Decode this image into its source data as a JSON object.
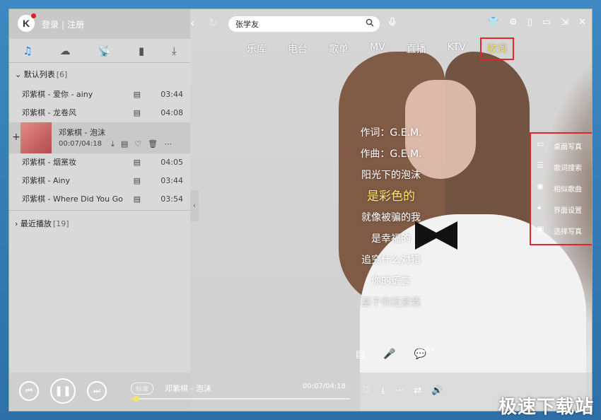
{
  "header": {
    "logo": "K",
    "login": "登录",
    "register": "注册",
    "search_value": "张学友",
    "back_icon": "‹",
    "refresh_icon": "↻",
    "search_icon": "⚲",
    "mic_icon": "🎙",
    "window_controls": [
      "skin-icon",
      "settings-icon",
      "mini-icon",
      "minimize-icon",
      "restore-icon",
      "close-icon"
    ]
  },
  "nav": {
    "tabs": [
      "乐库",
      "电台",
      "歌单",
      "MV",
      "直播",
      "KTV",
      "歌词"
    ],
    "active": "歌词"
  },
  "sidebar": {
    "icons": [
      "music-icon",
      "cloud-icon",
      "radio-icon",
      "device-icon",
      "download-icon"
    ],
    "default_list": {
      "title": "默认列表",
      "count": "[6]"
    },
    "songs": [
      {
        "title": "邓紫棋 - 爱你 - ainy",
        "duration": "03:44"
      },
      {
        "title": "邓紫棋 - 龙卷风",
        "duration": "04:08"
      }
    ],
    "playing": {
      "title": "邓紫棋 - 泡沫",
      "time": "00:07/04:18"
    },
    "songs_after": [
      {
        "title": "邓紫棋 - 烟黨妆",
        "duration": "04:05"
      },
      {
        "title": "邓紫棋 - Ainy",
        "duration": "03:44"
      },
      {
        "title": "邓紫棋 - Where Did You Go",
        "duration": "03:54"
      }
    ],
    "recent": {
      "title": "最近播放",
      "count": "[19]"
    }
  },
  "lyrics": {
    "lines": [
      {
        "text": "作词：G.E.M.",
        "state": "normal"
      },
      {
        "text": "作曲：G.E.M.",
        "state": "normal"
      },
      {
        "text": "阳光下的泡沫",
        "state": "normal"
      },
      {
        "text": "是彩色的",
        "state": "current"
      },
      {
        "text": "就像被骗的我",
        "state": "normal"
      },
      {
        "text": "是幸福的",
        "state": "normal"
      },
      {
        "text": "追究什么对错",
        "state": "normal"
      },
      {
        "text": "你的谎言",
        "state": "normal"
      },
      {
        "text": "基于你还爱我",
        "state": "fade"
      }
    ],
    "comment_count": "999+"
  },
  "right_menu": [
    {
      "label": "桌面写真",
      "icon": "desktop-photo-icon"
    },
    {
      "label": "歌词搜索",
      "icon": "lyric-search-icon"
    },
    {
      "label": "相似歌曲",
      "icon": "similar-songs-icon"
    },
    {
      "label": "界面设置",
      "icon": "ui-settings-icon"
    },
    {
      "label": "选择写真",
      "icon": "select-photo-icon"
    }
  ],
  "player": {
    "quality": "标准",
    "now_playing": "邓紫棋 - 泡沫",
    "time": "00:07/04:18",
    "progress": 0.027
  },
  "watermark": "极速下载站"
}
